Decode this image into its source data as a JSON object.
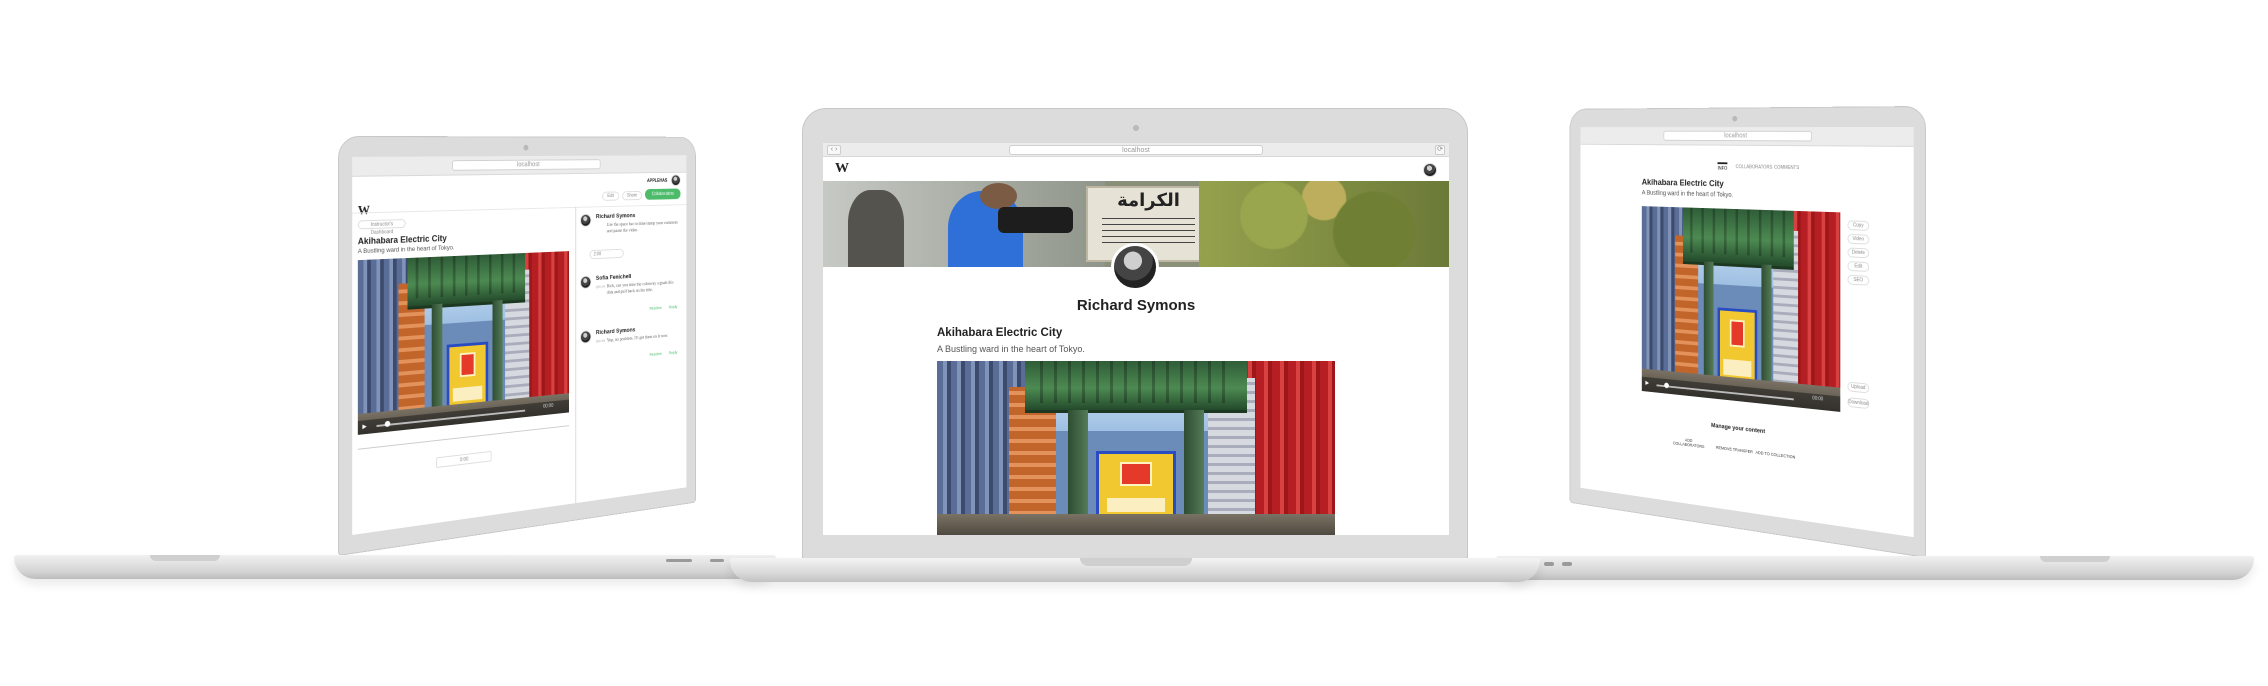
{
  "left_laptop": {
    "url": "localhost",
    "user_name": "APPLEHAS",
    "logo": "W",
    "breadcrumb": "Instructor's Dashboard",
    "video_title": "Akihabara Electric City",
    "video_subtitle": "A Bustling ward in the heart of Tokyo.",
    "video_time": "00:00",
    "buttons": {
      "edit": "Edit",
      "share": "Share",
      "collaborators": "Collaborators"
    },
    "page_input": "0:00",
    "comment_time_input": "2:00",
    "comments": [
      {
        "author": "Richard Symons",
        "meta": "@0:12",
        "text": "Use the space bar to time/stamp your comment and pause the video.",
        "actions": []
      },
      {
        "author": "Sofia Fenichell",
        "meta": "@0:34",
        "text": "Rick, can you time the colorway signals this dots and pull back on the title.",
        "actions": [
          "Resolve",
          "Reply"
        ]
      },
      {
        "author": "Richard Symons",
        "meta": "@0:45",
        "text": "Yup, no problem. I'll get them on it now.",
        "actions": [
          "Resolve",
          "Reply"
        ]
      }
    ]
  },
  "center_laptop": {
    "url": "localhost",
    "logo": "W",
    "banner_sign_text": "الكرامة",
    "profile_name": "Richard Symons",
    "video_title": "Akihabara Electric City",
    "video_subtitle": "A Bustling ward in the heart of Tokyo."
  },
  "right_laptop": {
    "url": "localhost",
    "tabs": [
      "INFO",
      "COLLABORATORS",
      "COMMENTS"
    ],
    "video_title": "Akihabara Electric City",
    "video_subtitle": "A Bustling ward in the heart of Tokyo.",
    "side_buttons": [
      "Copy",
      "Video",
      "Delete",
      "Edit",
      "SEO"
    ],
    "action_buttons": [
      "Upload",
      "Download"
    ],
    "manage_title": "Manage your content",
    "manage_actions": [
      "ADD COLLABORATORS",
      "REMOVE TRANSFER",
      "ADD TO COLLECTION"
    ],
    "video_time": "00:00"
  },
  "colors": {
    "accent_green": "#4cbb6a",
    "laptop_silver": "#dcdcdc"
  },
  "icons": [
    "camera-icon",
    "avatar-icon",
    "play-icon",
    "fullscreen-icon",
    "volume-icon"
  ]
}
